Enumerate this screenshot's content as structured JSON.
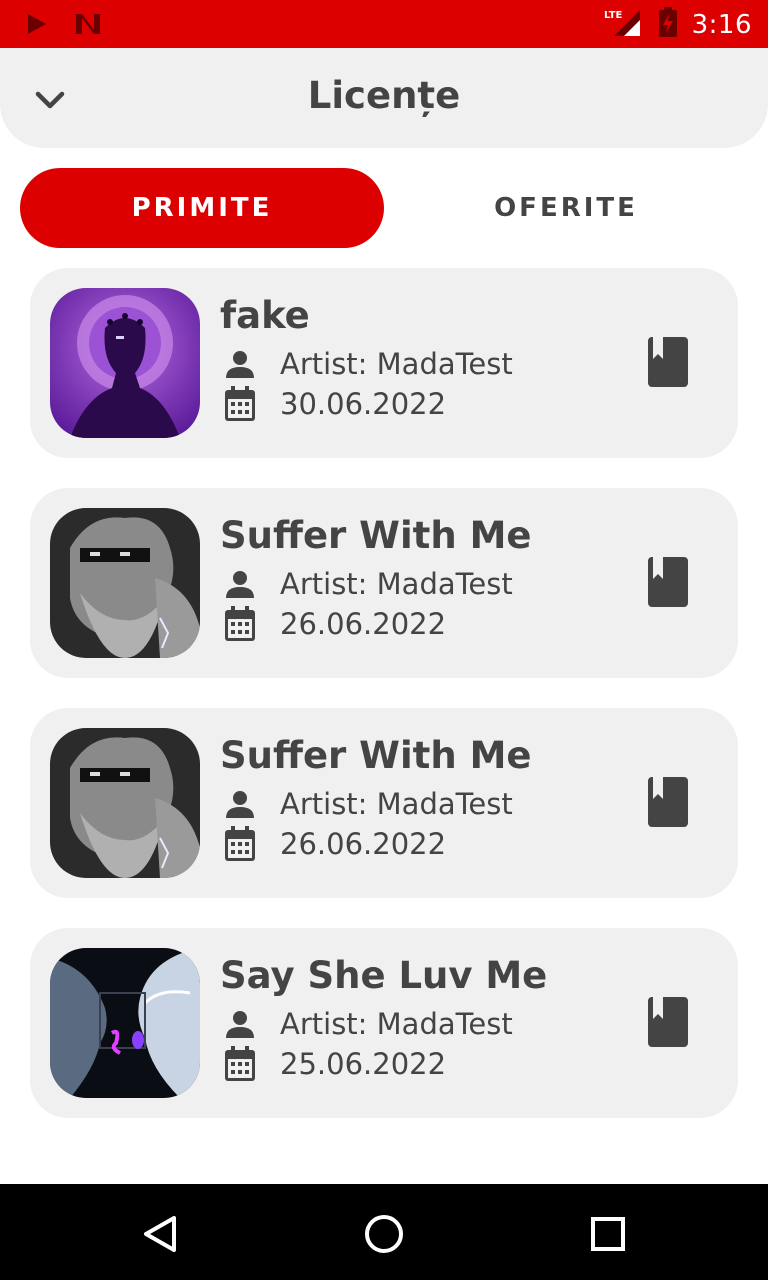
{
  "status_bar": {
    "time": "3:16",
    "network": "LTE",
    "icons": [
      "play-store-icon",
      "netflix-icon",
      "signal-icon",
      "battery-charging-icon"
    ],
    "color": "#dd0000"
  },
  "header": {
    "title": "Licențe",
    "back_icon": "chevron-down-icon"
  },
  "tabs": [
    {
      "label": "PRIMITE",
      "active": true
    },
    {
      "label": "OFERITE",
      "active": false
    }
  ],
  "accent_color": "#dd0000",
  "licenses": [
    {
      "title": "fake",
      "artist": "Artist: MadaTest",
      "date": "30.06.2022",
      "cover": "purple-figure-cover"
    },
    {
      "title": "Suffer With Me",
      "artist": "Artist: MadaTest",
      "date": "26.06.2022",
      "cover": "statue-cover"
    },
    {
      "title": "Suffer With Me",
      "artist": "Artist: MadaTest",
      "date": "26.06.2022",
      "cover": "statue-cover"
    },
    {
      "title": "Say She Luv Me",
      "artist": "Artist: MadaTest",
      "date": "25.06.2022",
      "cover": "faces-cover"
    }
  ],
  "nav_bar": {
    "icons": [
      "back-triangle-icon",
      "home-circle-icon",
      "recents-square-icon"
    ]
  }
}
